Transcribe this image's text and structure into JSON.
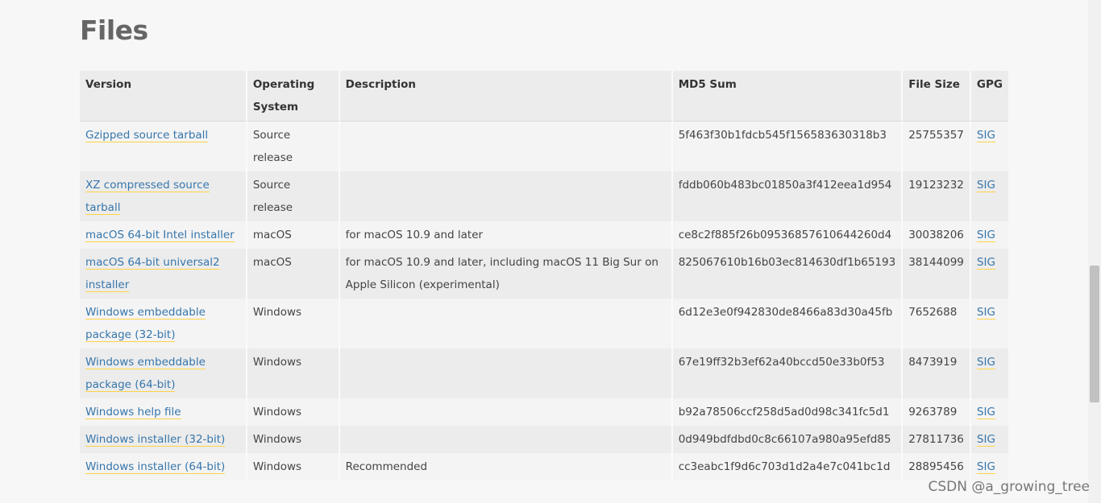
{
  "page": {
    "title": "Files"
  },
  "table": {
    "headers": [
      "Version",
      "Operating System",
      "Description",
      "MD5 Sum",
      "File Size",
      "GPG"
    ],
    "rows": [
      {
        "version": "Gzipped source tarball",
        "os": "Source release",
        "description": "",
        "md5": "5f463f30b1fdcb545f156583630318b3",
        "size": "25755357",
        "gpg": "SIG"
      },
      {
        "version": "XZ compressed source tarball",
        "os": "Source release",
        "description": "",
        "md5": "fddb060b483bc01850a3f412eea1d954",
        "size": "19123232",
        "gpg": "SIG"
      },
      {
        "version": "macOS 64-bit Intel installer",
        "os": "macOS",
        "description": "for macOS 10.9 and later",
        "md5": "ce8c2f885f26b09536857610644260d4",
        "size": "30038206",
        "gpg": "SIG"
      },
      {
        "version": "macOS 64-bit universal2 installer",
        "os": "macOS",
        "description": "for macOS 10.9 and later, including macOS 11 Big Sur on Apple Silicon (experimental)",
        "md5": "825067610b16b03ec814630df1b65193",
        "size": "38144099",
        "gpg": "SIG"
      },
      {
        "version": "Windows embeddable package (32-bit)",
        "os": "Windows",
        "description": "",
        "md5": "6d12e3e0f942830de8466a83d30a45fb",
        "size": "7652688",
        "gpg": "SIG"
      },
      {
        "version": "Windows embeddable package (64-bit)",
        "os": "Windows",
        "description": "",
        "md5": "67e19ff32b3ef62a40bccd50e33b0f53",
        "size": "8473919",
        "gpg": "SIG"
      },
      {
        "version": "Windows help file",
        "os": "Windows",
        "description": "",
        "md5": "b92a78506ccf258d5ad0d98c341fc5d1",
        "size": "9263789",
        "gpg": "SIG"
      },
      {
        "version": "Windows installer (32-bit)",
        "os": "Windows",
        "description": "",
        "md5": "0d949bdfdbd0c8c66107a980a95efd85",
        "size": "27811736",
        "gpg": "SIG"
      },
      {
        "version": "Windows installer (64-bit)",
        "os": "Windows",
        "description": "Recommended",
        "md5": "cc3eabc1f9d6c703d1d2a4e7c041bc1d",
        "size": "28895456",
        "gpg": "SIG"
      }
    ]
  },
  "watermark": "CSDN @a_growing_tree",
  "colors": {
    "link": "#3776ab",
    "link_underline": "#ffd343",
    "header_bg": "#ececec",
    "page_bg": "#f7f7f7"
  }
}
